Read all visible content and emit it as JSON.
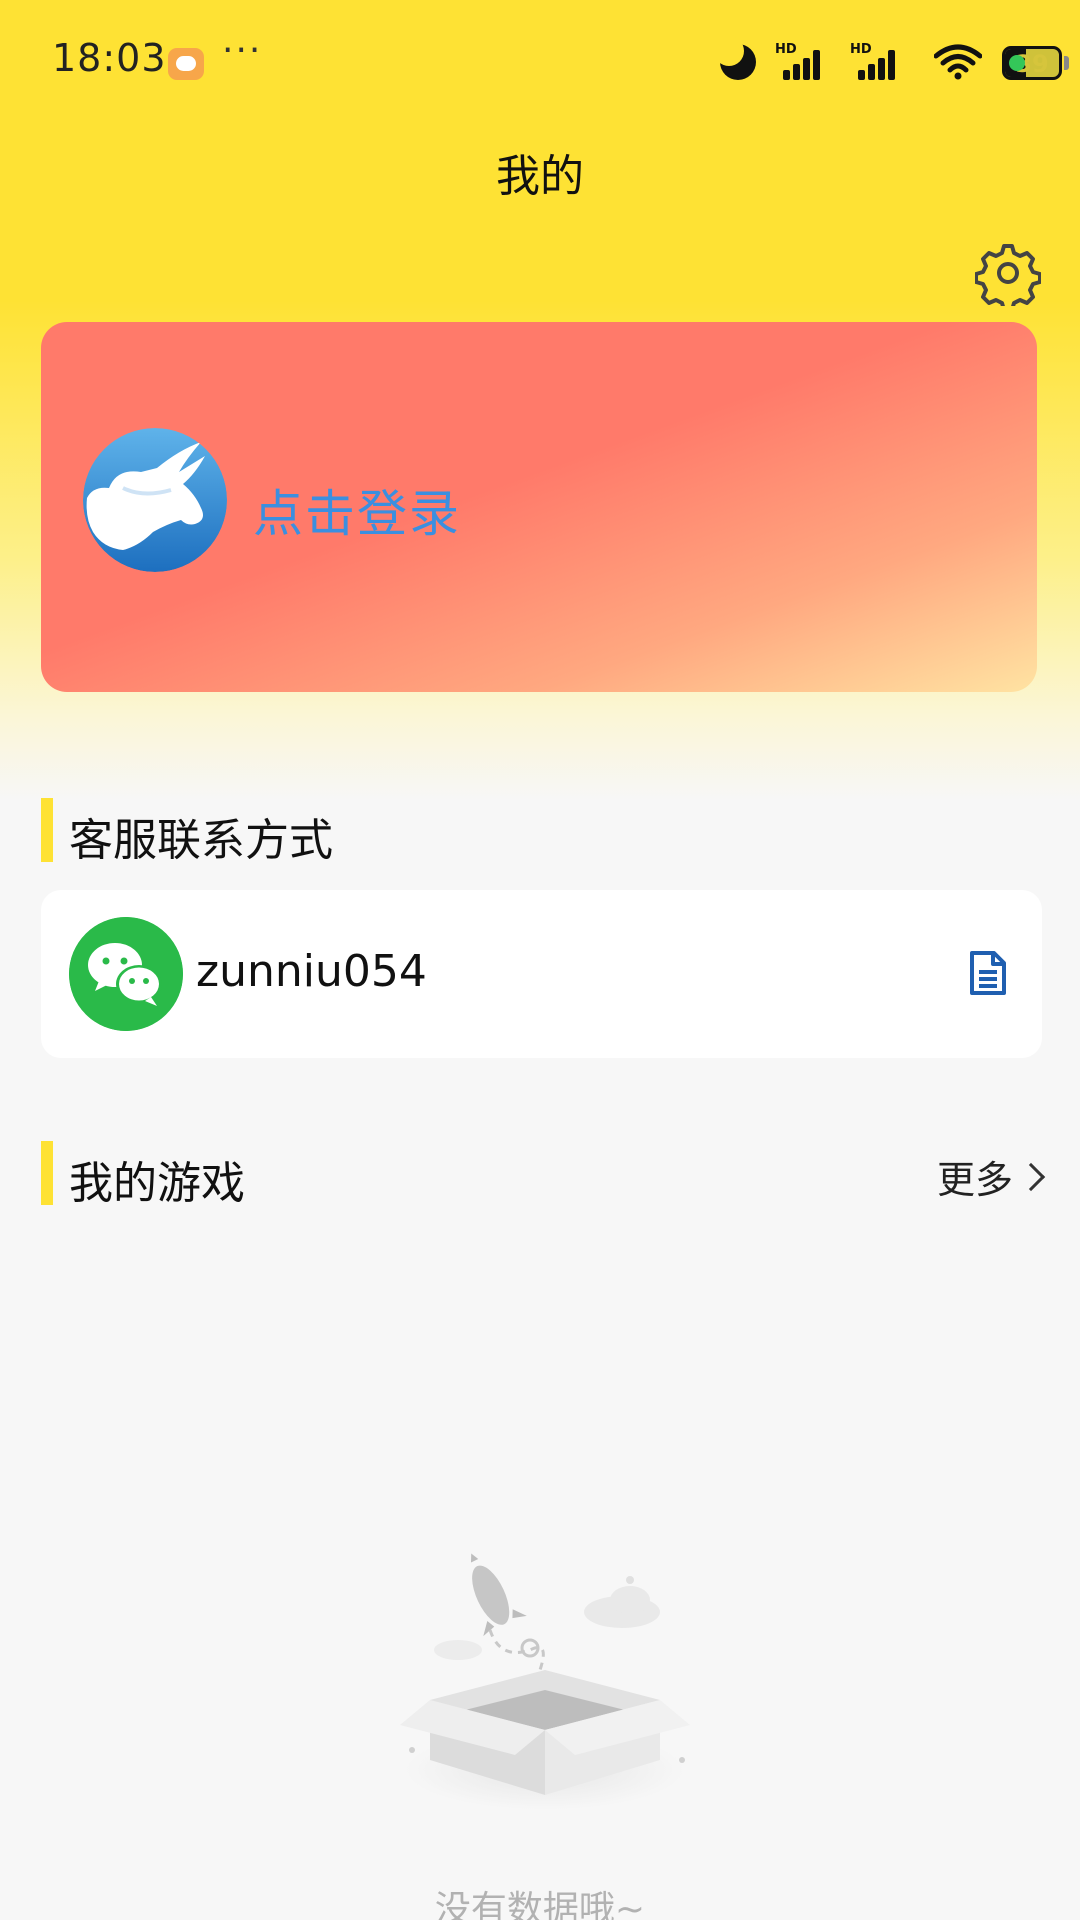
{
  "status_bar": {
    "time": "18:03",
    "more": "···",
    "network_1": "HD",
    "network_2": "HD",
    "battery_level": "39"
  },
  "header": {
    "title": "我的"
  },
  "login_card": {
    "label": "点击登录"
  },
  "contact_section": {
    "title": "客服联系方式",
    "wechat_id": "zunniu054"
  },
  "games_section": {
    "title": "我的游戏",
    "more_label": "更多"
  },
  "empty_state": {
    "message": "没有数据哦~"
  },
  "colors": {
    "accent_yellow": "#fee234",
    "card_coral": "#ff7a6a",
    "login_blue": "#3b8fe0",
    "wechat_green": "#2aba49",
    "copy_icon_blue": "#1f5fb0"
  },
  "icons": [
    "notification-icon",
    "moon-icon",
    "signal-icon",
    "wifi-icon",
    "battery-icon",
    "settings-gear-icon",
    "bull-logo-icon",
    "wechat-icon",
    "copy-document-icon",
    "chevron-right-icon",
    "empty-box-illustration"
  ]
}
